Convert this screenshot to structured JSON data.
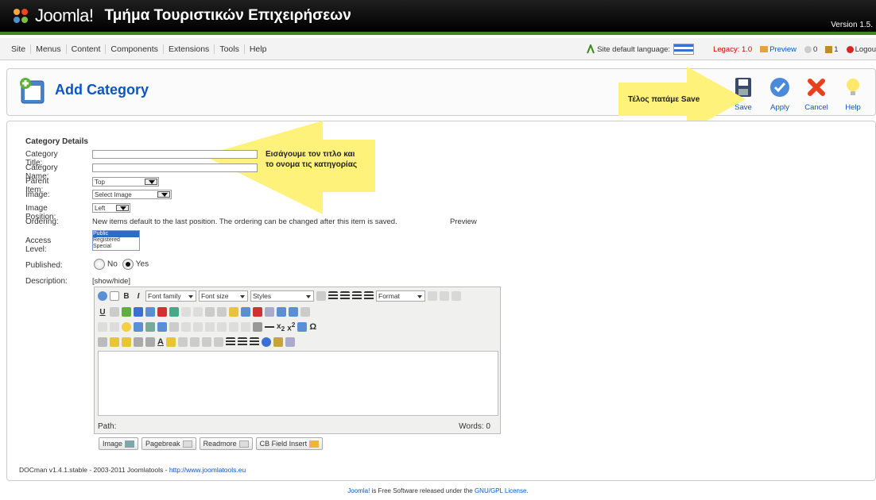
{
  "header": {
    "logo_text": "Joomla!",
    "site_title": "Τμήμα Τουριστικών Επιχειρήσεων",
    "version": "Version 1.5."
  },
  "menu": {
    "items": [
      "Site",
      "Menus",
      "Content",
      "Components",
      "Extensions",
      "Tools",
      "Help"
    ]
  },
  "status": {
    "lang_label": "Site default language:",
    "legacy": "Legacy: 1.0",
    "preview": "Preview",
    "messages_count": "0",
    "users_count": "1",
    "logout": "Logou"
  },
  "toolbar": {
    "title": "Add Category",
    "save": "Save",
    "apply": "Apply",
    "cancel": "Cancel",
    "help": "Help"
  },
  "annotations": {
    "save_note": "Τέλος πατάμε Save",
    "title_note_line1": "Εισάγουμε τον τιτλο και",
    "title_note_line2": "το ονομα τις κατηγορίας"
  },
  "form": {
    "section_title": "Category Details",
    "title_label": "Category Title:",
    "title_value": "",
    "name_label": "Category Name:",
    "name_value": "",
    "parent_label": "Parent Item:",
    "parent_value": "Top",
    "image_label": "Image:",
    "image_value": "Select Image",
    "image_pos_label": "Image Position:",
    "image_pos_value": "Left",
    "ordering_label": "Ordering:",
    "ordering_text": "New items default to the last position. The ordering can be changed after this item is saved.",
    "preview_label": "Preview",
    "access_label": "Access Level:",
    "access_options": [
      "Public",
      "Registered",
      "Special"
    ],
    "published_label": "Published:",
    "published_no": "No",
    "published_yes": "Yes",
    "description_label": "Description:",
    "show_hide": "[show/hide]"
  },
  "editor": {
    "font_family": "Font family",
    "font_size": "Font size",
    "styles": "Styles",
    "format": "Format",
    "path_label": "Path:",
    "words": "Words: 0",
    "buttons": [
      "Image",
      "Pagebreak",
      "Readmore",
      "CB Field Insert"
    ]
  },
  "footer": {
    "docman_text": "DOCman v1.4.1.stable - 2003-2011 Joomlatools - ",
    "docman_link": "http://www.joomlatools.eu",
    "joomla_link": "Joomla!",
    "joomla_text": " is Free Software released under the ",
    "license_link": "GNU/GPL License",
    "period": "."
  },
  "colors": {
    "accent_blue": "#0b55c4",
    "header_green": "#3b8a1b",
    "callout_yellow": "#fff27a"
  }
}
